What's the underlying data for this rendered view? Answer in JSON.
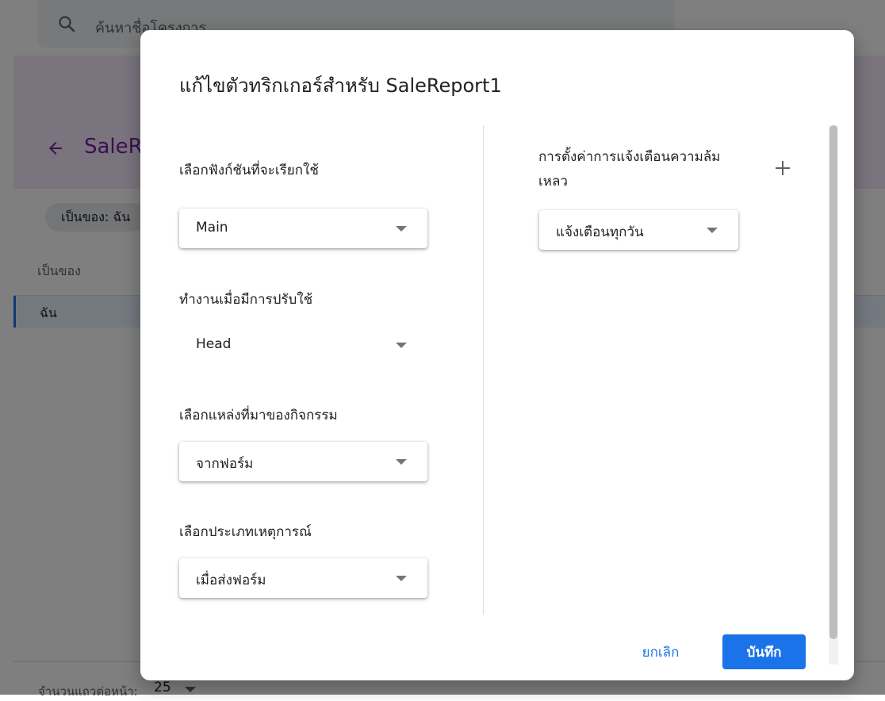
{
  "background": {
    "search": {
      "placeholder": "ค้นหาชื่อโครงการ"
    },
    "project_title": "SaleReport1",
    "owner_chip": "เป็นของ: ฉัน",
    "table": {
      "header": "เป็นของ",
      "row": "ฉัน"
    },
    "pagination": {
      "label": "จำนวนแถวต่อหน้า:",
      "value": "25"
    }
  },
  "dialog": {
    "title": "แก้ไขตัวทริกเกอร์สำหรับ SaleReport1",
    "function": {
      "label": "เลือกฟังก์ชันที่จะเรียกใช้",
      "value": "Main"
    },
    "deployment": {
      "label": "ทำงานเมื่อมีการปรับใช้",
      "value": "Head"
    },
    "event_source": {
      "label": "เลือกแหล่งที่มาของกิจกรรม",
      "value": "จากฟอร์ม"
    },
    "event_type": {
      "label": "เลือกประเภทเหตุการณ์",
      "value": "เมื่อส่งฟอร์ม"
    },
    "failure_notification": {
      "label": "การตั้งค่าการแจ้งเตือนความล้มเหลว",
      "value": "แจ้งเตือนทุกวัน"
    },
    "buttons": {
      "cancel": "ยกเลิก",
      "save": "บันทึก"
    }
  },
  "icons": {
    "search": "search-icon",
    "back": "arrow-back-icon",
    "add": "plus-icon",
    "dropdown": "caret-down-icon"
  },
  "colors": {
    "accent": "#1a73e8",
    "project_title": "#7b1fa2",
    "header_band": "#f3e8fd",
    "scrim": "rgba(0,0,0,0.5)"
  }
}
